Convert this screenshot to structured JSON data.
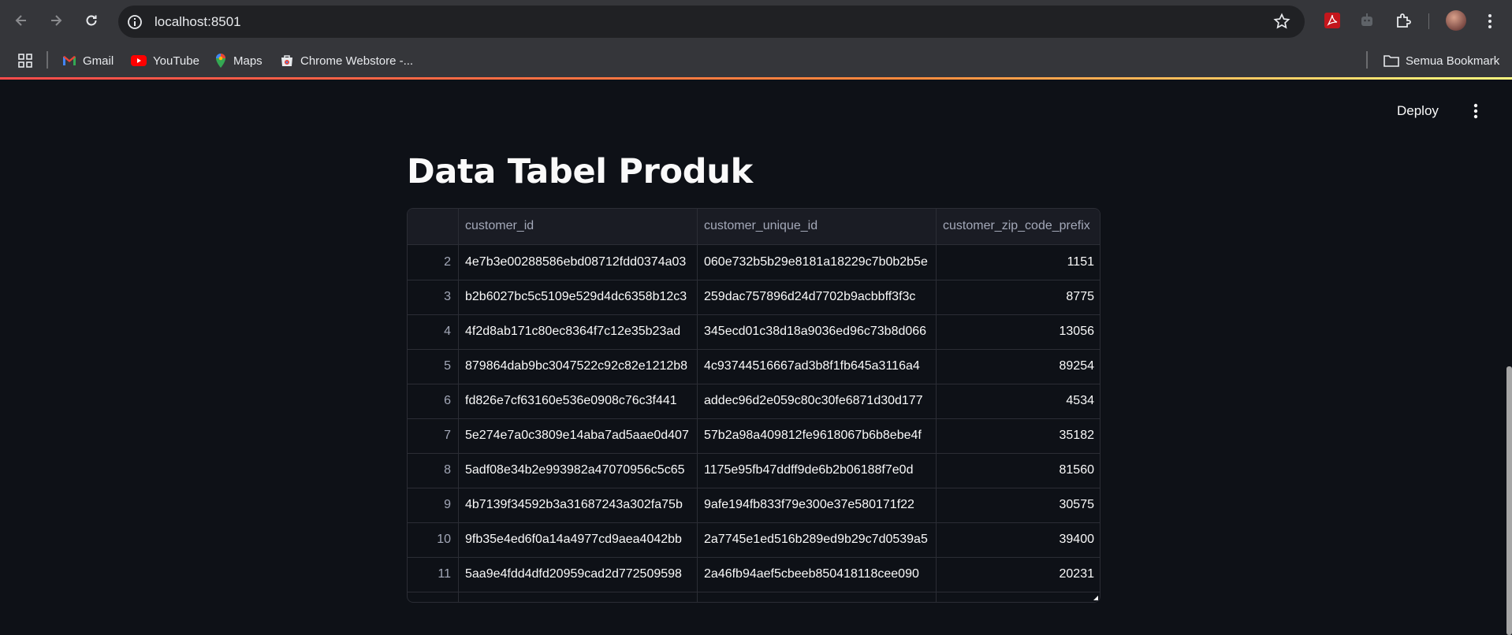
{
  "browser": {
    "url": "localhost:8501",
    "bookmarks": [
      {
        "label": "Gmail",
        "icon": "gmail-icon"
      },
      {
        "label": "YouTube",
        "icon": "youtube-icon"
      },
      {
        "label": "Maps",
        "icon": "maps-icon"
      },
      {
        "label": "Chrome Webstore -...",
        "icon": "webstore-icon"
      }
    ],
    "all_bookmarks": "Semua Bookmark"
  },
  "app": {
    "deploy_label": "Deploy",
    "title": "Data Tabel Produk"
  },
  "table": {
    "columns": [
      "",
      "customer_id",
      "customer_unique_id",
      "customer_zip_code_prefix"
    ],
    "rows": [
      {
        "idx": "2",
        "customer_id": "4e7b3e00288586ebd08712fdd0374a03",
        "customer_unique_id": "060e732b5b29e8181a18229c7b0b2b5e",
        "zip": "1151"
      },
      {
        "idx": "3",
        "customer_id": "b2b6027bc5c5109e529d4dc6358b12c3",
        "customer_unique_id": "259dac757896d24d7702b9acbbff3f3c",
        "zip": "8775"
      },
      {
        "idx": "4",
        "customer_id": "4f2d8ab171c80ec8364f7c12e35b23ad",
        "customer_unique_id": "345ecd01c38d18a9036ed96c73b8d066",
        "zip": "13056"
      },
      {
        "idx": "5",
        "customer_id": "879864dab9bc3047522c92c82e1212b8",
        "customer_unique_id": "4c93744516667ad3b8f1fb645a3116a4",
        "zip": "89254"
      },
      {
        "idx": "6",
        "customer_id": "fd826e7cf63160e536e0908c76c3f441",
        "customer_unique_id": "addec96d2e059c80c30fe6871d30d177",
        "zip": "4534"
      },
      {
        "idx": "7",
        "customer_id": "5e274e7a0c3809e14aba7ad5aae0d407",
        "customer_unique_id": "57b2a98a409812fe9618067b6b8ebe4f",
        "zip": "35182"
      },
      {
        "idx": "8",
        "customer_id": "5adf08e34b2e993982a47070956c5c65",
        "customer_unique_id": "1175e95fb47ddff9de6b2b06188f7e0d",
        "zip": "81560"
      },
      {
        "idx": "9",
        "customer_id": "4b7139f34592b3a31687243a302fa75b",
        "customer_unique_id": "9afe194fb833f79e300e37e580171f22",
        "zip": "30575"
      },
      {
        "idx": "10",
        "customer_id": "9fb35e4ed6f0a14a4977cd9aea4042bb",
        "customer_unique_id": "2a7745e1ed516b289ed9b29c7d0539a5",
        "zip": "39400"
      },
      {
        "idx": "11",
        "customer_id": "5aa9e4fdd4dfd20959cad2d772509598",
        "customer_unique_id": "2a46fb94aef5cbeeb850418118cee090",
        "zip": "20231"
      }
    ]
  },
  "colors": {
    "app_background": "#0e1117",
    "chrome": "#35363a",
    "accent_start": "#ff4b4b",
    "accent_end": "#fffd80"
  }
}
